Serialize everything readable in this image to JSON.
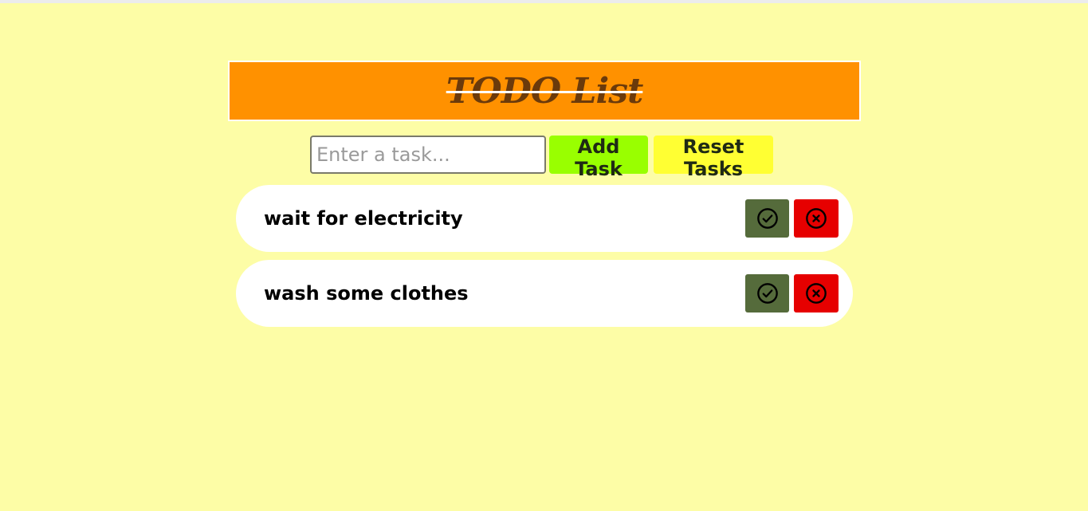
{
  "app": {
    "title": "TODO List"
  },
  "controls": {
    "input_value": "",
    "input_placeholder": "Enter a task...",
    "add_label": "Add Task",
    "reset_label": "Reset Tasks"
  },
  "tasks": [
    {
      "text": "wait for electricity",
      "done_icon": "check-circle-icon",
      "delete_icon": "x-circle-icon"
    },
    {
      "text": "wash some clothes",
      "done_icon": "check-circle-icon",
      "delete_icon": "x-circle-icon"
    }
  ],
  "colors": {
    "background": "#fdfda6",
    "header": "#ff9100",
    "add_button": "#99ff00",
    "reset_button": "#ffff33",
    "done_button": "#556b3b",
    "delete_button": "#e60000"
  }
}
